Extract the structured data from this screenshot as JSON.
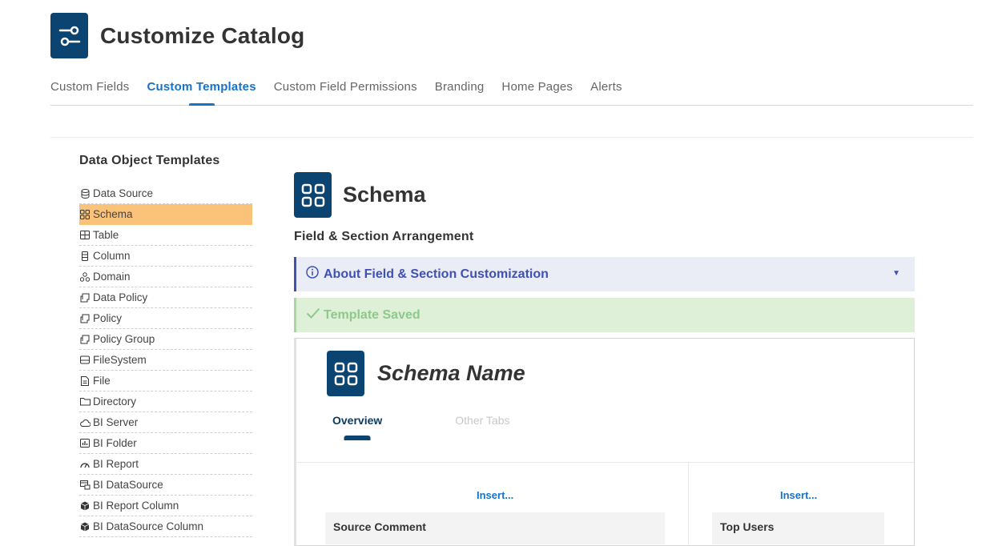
{
  "app": {
    "title": "Customize Catalog",
    "icon": "sliders-icon",
    "brand_color": "#0b4470",
    "accent_color": "#1773c9"
  },
  "tabs": [
    {
      "label": "Custom Fields",
      "active": false
    },
    {
      "label": "Custom Templates",
      "active": true
    },
    {
      "label": "Custom Field Permissions",
      "active": false
    },
    {
      "label": "Branding",
      "active": false
    },
    {
      "label": "Home Pages",
      "active": false
    },
    {
      "label": "Alerts",
      "active": false
    }
  ],
  "sidebar": {
    "title": "Data Object Templates",
    "items": [
      {
        "label": "Data Source",
        "icon": "database-icon",
        "active": false
      },
      {
        "label": "Schema",
        "icon": "grid-icon",
        "active": true
      },
      {
        "label": "Table",
        "icon": "table-icon",
        "active": false
      },
      {
        "label": "Column",
        "icon": "column-icon",
        "active": false
      },
      {
        "label": "Domain",
        "icon": "domain-icon",
        "active": false
      },
      {
        "label": "Data Policy",
        "icon": "policy-icon",
        "active": false
      },
      {
        "label": "Policy",
        "icon": "policy-icon",
        "active": false
      },
      {
        "label": "Policy Group",
        "icon": "policy-icon",
        "active": false
      },
      {
        "label": "FileSystem",
        "icon": "drive-icon",
        "active": false
      },
      {
        "label": "File",
        "icon": "file-icon",
        "active": false
      },
      {
        "label": "Directory",
        "icon": "folder-icon",
        "active": false
      },
      {
        "label": "BI Server",
        "icon": "cloud-icon",
        "active": false
      },
      {
        "label": "BI Folder",
        "icon": "chart-folder-icon",
        "active": false
      },
      {
        "label": "BI Report",
        "icon": "gauge-icon",
        "active": false
      },
      {
        "label": "BI DataSource",
        "icon": "bi-datasource-icon",
        "active": false
      },
      {
        "label": "BI Report Column",
        "icon": "cube-icon",
        "active": false
      },
      {
        "label": "BI DataSource Column",
        "icon": "cube-icon",
        "active": false
      }
    ]
  },
  "main": {
    "object_title": "Schema",
    "object_icon": "grid-icon",
    "section_heading": "Field & Section Arrangement",
    "info_bar": {
      "label": "About Field & Section Customization",
      "icon": "info-icon",
      "color": "#3f51b5"
    },
    "success_bar": {
      "label": "Template Saved",
      "icon": "check-icon",
      "color": "#8cc98a"
    },
    "preview": {
      "title": "Schema Name",
      "tabs": [
        {
          "label": "Overview",
          "active": true
        },
        {
          "label": "Other Tabs",
          "active": false
        }
      ],
      "left_insert": "Insert...",
      "right_insert": "Insert...",
      "left_card": "Source Comment",
      "right_card": "Top Users"
    }
  }
}
